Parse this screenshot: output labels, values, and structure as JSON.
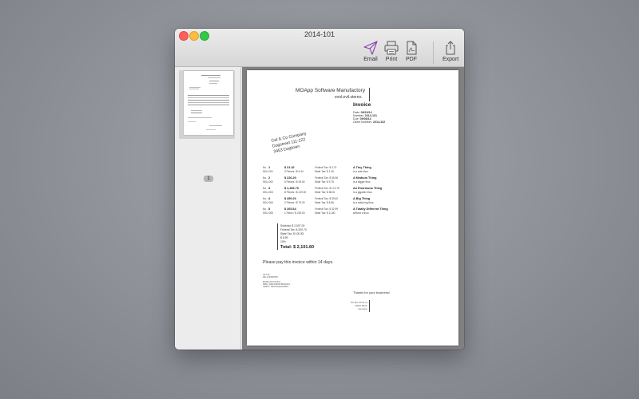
{
  "window": {
    "title": "2014-101",
    "toolbar": {
      "email": "Email",
      "print": "Print",
      "pdf": "PDF",
      "export": "Export"
    }
  },
  "sidebar": {
    "page_number": "1"
  },
  "invoice": {
    "company": "MOApp Software Manufactory",
    "company_sub": "evol.evil.stereo.",
    "title": "Invoice",
    "meta": [
      {
        "label": "Date: ",
        "value": "08/19/14"
      },
      {
        "label": "Number: ",
        "value": "2014-101"
      },
      {
        "label": "Due: ",
        "value": "09/08/14"
      },
      {
        "label": "Client Number: ",
        "value": "2014-102"
      }
    ],
    "recipient": [
      "Cat & Co Company",
      "Dogstreet 111-222",
      "3453 Dogtown"
    ],
    "items": [
      {
        "qty_label": "No.",
        "qty": "1",
        "sku": "SKU-001",
        "price": "$ 31.32",
        "price_sub": "3 Pieces / $ 9.44",
        "tax1": "Federal Tax: $ 4.73",
        "tax2": "State Tax: $ 1.26",
        "name": "A Tiny Thing",
        "desc": "is a cute thus"
      },
      {
        "qty_label": "No.",
        "qty": "2",
        "sku": "SKU-002",
        "price": "$ 226.20",
        "price_sub": "5 Pieces / $ 49.60",
        "tax1": "Federal Tax: $ 35.96",
        "tax2": "State Tax: $ 9.75",
        "name": "A Medium Thing",
        "desc": "is a bigger thus"
      },
      {
        "qty_label": "No.",
        "qty": "3",
        "sku": "SKU-003",
        "price": "$ 1,366.76",
        "price_sub": "8 Pieces / $ 129.00",
        "tax1": "Federal Tax: $ 174.76",
        "tax2": "State Tax: $ 38.51",
        "name": "An Enormous Thing",
        "desc": "is a gigantic thus"
      },
      {
        "qty_label": "No.",
        "qty": "4",
        "sku": "SKU-004",
        "price": "$ 459.20",
        "price_sub": "2 Pieces / $ 79.00",
        "tax1": "Federal Tax: $ 39.60",
        "tax2": "State Tax: $ 8.86",
        "name": "A Big Thing",
        "desc": "is a really big thus"
      },
      {
        "qty_label": "No.",
        "qty": "5",
        "sku": "SKU-005",
        "price": "$ 265.64",
        "price_sub": "1 Piece / $ 229.00",
        "tax1": "Federal Tax: $ 32.99",
        "tax2": "State Tax: $ 11.80",
        "name": "A Totally Different Thing",
        "desc": "without a thus"
      }
    ],
    "summary": [
      "Subtotal: $ 2,007.00",
      "Federal Tax: $ 200.70",
      "State Tax: $ 100.35",
      "$ 6.99",
      "10%"
    ],
    "total": "Total: $ 2,101.60",
    "pay_note": "Please pay this invoice within 14 days.",
    "bank_lines": [
      "VAT ID",
      "DE 123456789"
    ],
    "bank_lines2": [
      "BANK ACCOUNT",
      "IBAN: DE12345678901234",
      "SWIFT: DEUTDE1234567"
    ],
    "thanks": "Thanks for your business!",
    "footer": [
      "PO Box 00 01 11",
      "10001 Berlin",
      "Germany"
    ]
  },
  "colors": {
    "close": "#fc605c",
    "minimize": "#fdbc40",
    "maximize": "#34c84a",
    "viewer_bg": "#808080"
  },
  "icons": {
    "email": "paper-plane-icon",
    "print": "printer-icon",
    "pdf": "pdf-document-icon",
    "export": "share-icon"
  }
}
